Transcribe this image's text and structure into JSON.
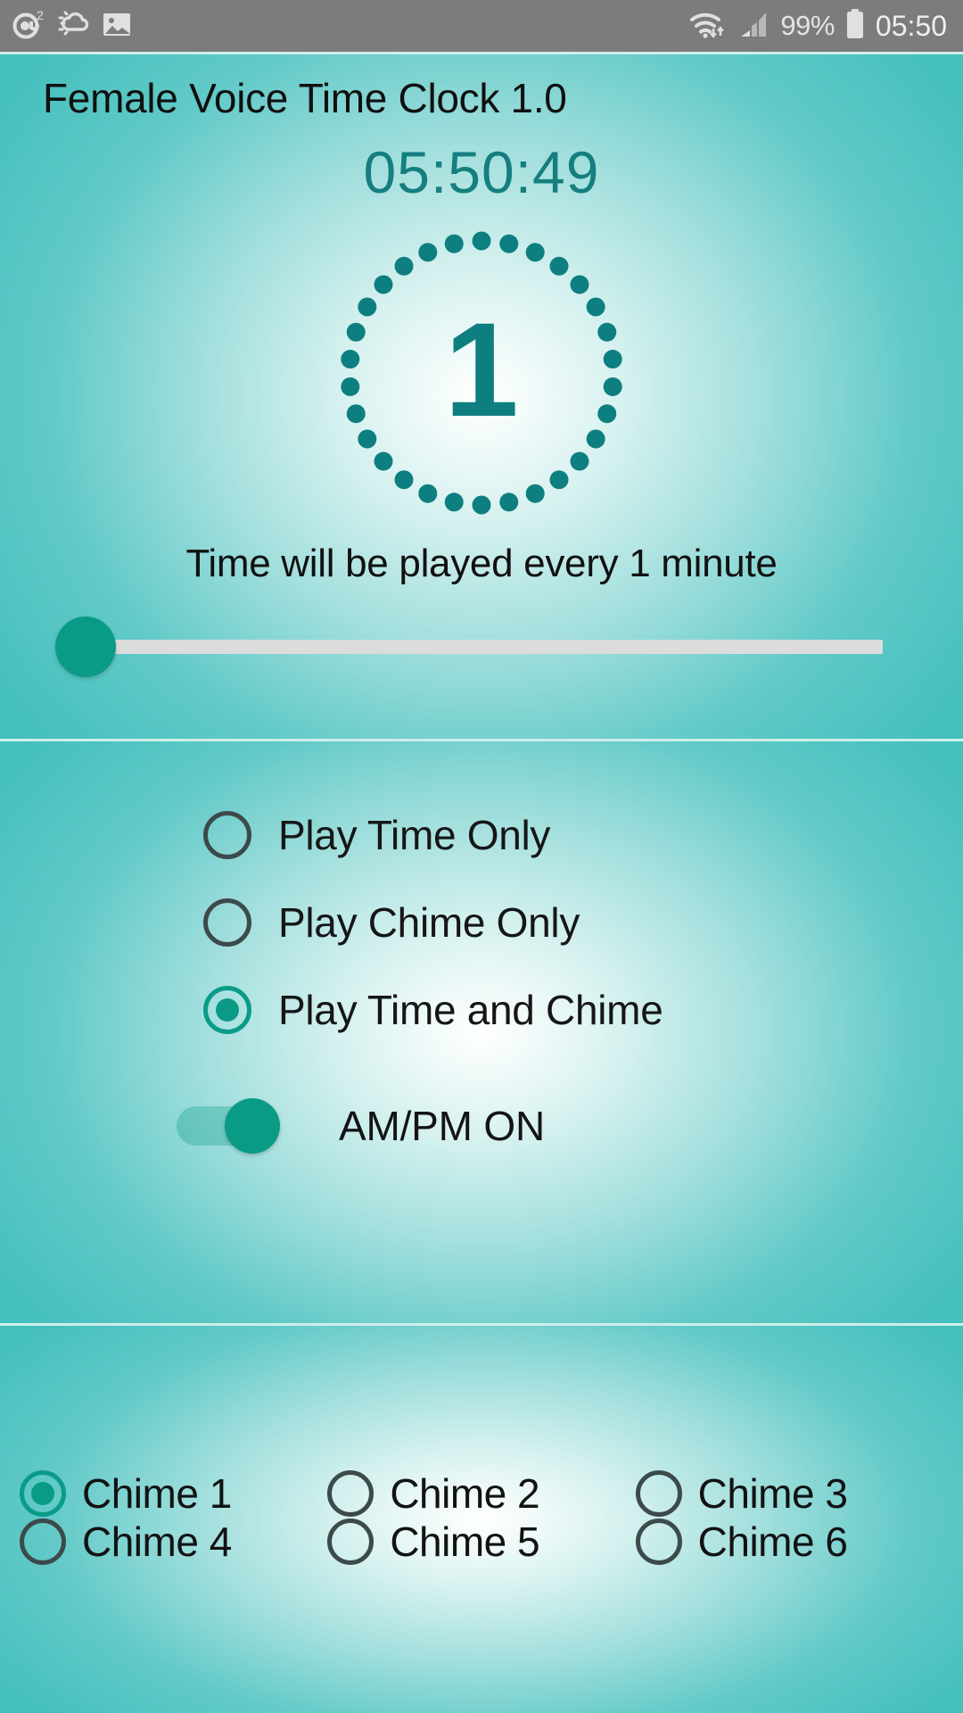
{
  "statusbar": {
    "icons": [
      "email-icon",
      "weather-icon",
      "gallery-icon",
      "wifi-icon",
      "cellular-signal-icon",
      "battery-icon"
    ],
    "email_badge": "2",
    "battery_percent": "99%",
    "clock": "05:50"
  },
  "app": {
    "title": "Female Voice Time Clock 1.0",
    "current_time": "05:50:49",
    "interval_value": "1",
    "interval_text": "Time will be played every 1 minute",
    "slider": {
      "value": 0,
      "min": 0,
      "max": 60
    },
    "dial": {
      "dots": 30,
      "filled_dots": 30
    }
  },
  "mode_options": [
    {
      "label": "Play Time Only",
      "selected": false
    },
    {
      "label": "Play Chime Only",
      "selected": false
    },
    {
      "label": "Play Time and Chime",
      "selected": true
    }
  ],
  "ampm_toggle": {
    "label": "AM/PM ON",
    "on": true
  },
  "chimes": [
    {
      "label": "Chime 1",
      "selected": true
    },
    {
      "label": "Chime 2",
      "selected": false
    },
    {
      "label": "Chime 3",
      "selected": false
    },
    {
      "label": "Chime 4",
      "selected": false
    },
    {
      "label": "Chime 5",
      "selected": false
    },
    {
      "label": "Chime 6",
      "selected": false
    }
  ],
  "colors": {
    "accent": "#0a9b87",
    "teal_dark": "#157f7f",
    "card_edge": "#43bfbc",
    "statusbar_bg": "#7c7c7c"
  }
}
